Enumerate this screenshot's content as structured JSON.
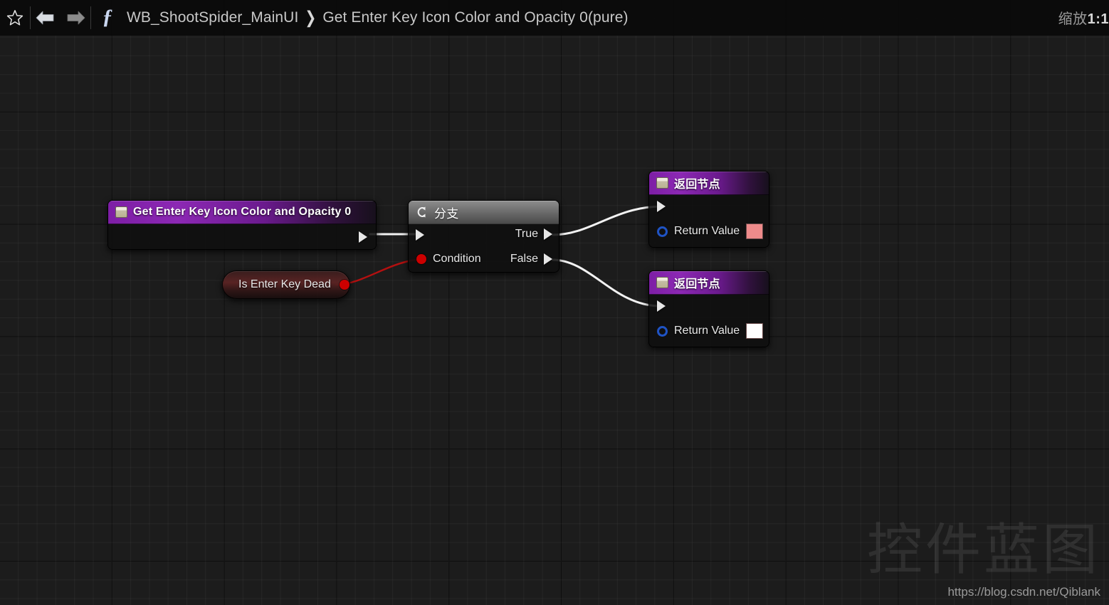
{
  "toolbar": {
    "bookmark_icon": "star-icon",
    "back_icon": "back-arrow-icon",
    "forward_icon": "forward-arrow-icon",
    "function_icon": "fx-icon",
    "breadcrumb": {
      "root": "WB_ShootSpider_MainUI",
      "separator": "❯",
      "current": "Get Enter Key Icon Color and Opacity 0(pure)"
    },
    "zoom": {
      "prefix": "缩放",
      "value": "1:1"
    }
  },
  "graph": {
    "entry_node": {
      "title": "Get Enter Key Icon Color and Opacity 0",
      "icon": "function-entry-icon",
      "exec_out": "exec-out-pin"
    },
    "branch_node": {
      "title": "分支",
      "icon": "branch-icon",
      "exec_in": "exec-in-pin",
      "condition_label": "Condition",
      "true_label": "True",
      "false_label": "False"
    },
    "variable_node": {
      "label": "Is Enter Key Dead",
      "pin_color": "#cc0000"
    },
    "return_nodes": [
      {
        "title": "返回节点",
        "icon": "function-result-icon",
        "return_label": "Return Value",
        "swatch_color": "#ee8b8b"
      },
      {
        "title": "返回节点",
        "icon": "function-result-icon",
        "return_label": "Return Value",
        "swatch_color": "#ffffff"
      }
    ],
    "wire_colors": {
      "exec": "#f2f2f2",
      "bool": "#b41010"
    }
  },
  "watermark": {
    "text": "控件蓝图",
    "url": "https://blog.csdn.net/Qiblank"
  }
}
